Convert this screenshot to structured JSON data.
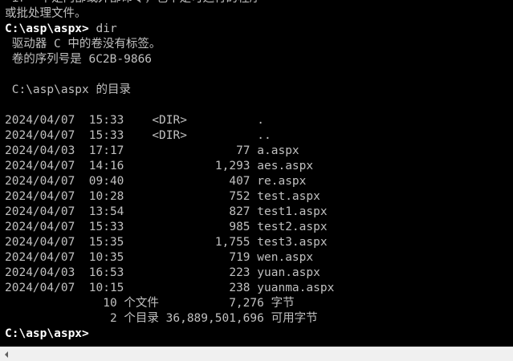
{
  "terminal": {
    "background": "#000000",
    "text_color": "#c0c0c0",
    "prompt_color": "#ffffff",
    "lines": [
      {
        "text": "'ir' 不是内部或外部命令，也不是可运行的程序"
      },
      {
        "text": "或批处理文件。"
      },
      {
        "prompt": "C:\\asp\\aspx>",
        "command": " dir"
      },
      {
        "text": " 驱动器 C 中的卷没有标签。"
      },
      {
        "text": " 卷的序列号是 6C2B-9866"
      },
      {
        "text": ""
      },
      {
        "text": " C:\\asp\\aspx 的目录"
      },
      {
        "text": ""
      },
      {
        "text": "2024/04/07  15:33    <DIR>          ."
      },
      {
        "text": "2024/04/07  15:33    <DIR>          .."
      },
      {
        "text": "2024/04/03  17:17                77 a.aspx"
      },
      {
        "text": "2024/04/07  14:16             1,293 aes.aspx"
      },
      {
        "text": "2024/04/07  09:40               407 re.aspx"
      },
      {
        "text": "2024/04/07  10:28               752 test.aspx"
      },
      {
        "text": "2024/04/07  13:54               827 test1.aspx"
      },
      {
        "text": "2024/04/07  15:33               985 test2.aspx"
      },
      {
        "text": "2024/04/07  15:35             1,755 test3.aspx"
      },
      {
        "text": "2024/04/07  10:35               719 wen.aspx"
      },
      {
        "text": "2024/04/03  16:53               223 yuan.aspx"
      },
      {
        "text": "2024/04/07  10:15               238 yuanma.aspx"
      },
      {
        "text": "              10 个文件          7,276 字节"
      },
      {
        "text": "               2 个目录 36,889,501,696 可用字节"
      },
      {
        "prompt": "C:\\asp\\aspx>",
        "command": ""
      }
    ]
  },
  "scrollbar": {
    "left_arrow_icon": "triangle-left-icon"
  }
}
